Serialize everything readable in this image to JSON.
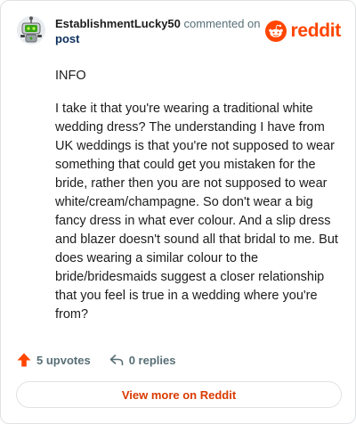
{
  "header": {
    "username": "EstablishmentLucky50",
    "action_text": "commented on",
    "post_link": "post",
    "brand": "reddit",
    "avatar_icon": "snoo-avatar-icon",
    "brand_icon": "reddit-logo-icon"
  },
  "comment": {
    "paragraphs": [
      "INFO",
      "I take it that you're wearing a traditional white wedding dress? The understanding I have from UK weddings is that you're not supposed to wear something that could get you mistaken for the bride, rather then you are not supposed to wear white/cream/champagne. So don't wear a big fancy dress in what ever colour. And a slip dress and blazer doesn't sound all that bridal to me. But does wearing a similar colour to the bride/bridesmaids suggest a closer relationship that you feel is true in a wedding where you're from?"
    ]
  },
  "actions": {
    "upvotes": "5 upvotes",
    "replies": "0 replies",
    "upvote_icon": "upvote-arrow-icon",
    "reply_icon": "reply-arrow-icon"
  },
  "footer": {
    "view_more": "View more on Reddit"
  },
  "colors": {
    "brand": "#ff4500",
    "link": "#0a2e5c",
    "muted": "#576f76",
    "view_more": "#d93a00",
    "border": "#dfe2e5"
  }
}
